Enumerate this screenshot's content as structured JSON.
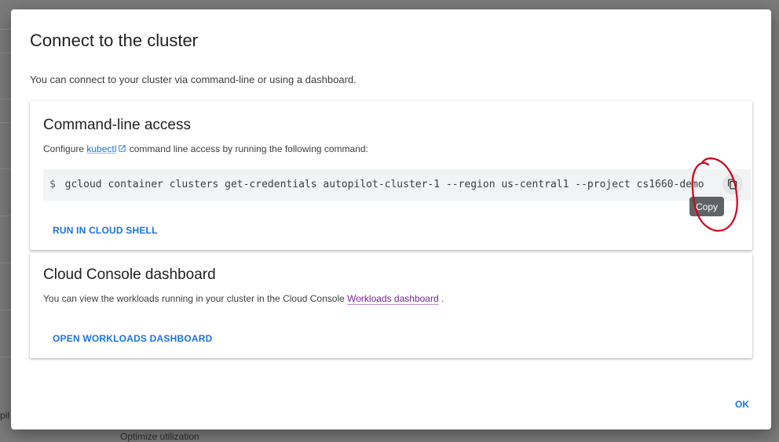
{
  "background": {
    "left_fragment": "pil",
    "bottom_fragment": "Optimize utilization"
  },
  "dialog": {
    "title": "Connect to the cluster",
    "subtitle": "You can connect to your cluster via command-line or using a dashboard.",
    "cli": {
      "title": "Command-line access",
      "text_before": "Configure ",
      "link_label": "kubectl",
      "link_icon": "external-link-icon",
      "text_after": " command line access by running the following command:",
      "prompt": "$",
      "command": "gcloud container clusters get-credentials autopilot-cluster-1 --region us-central1 --project cs1660-demo",
      "copy_icon": "copy-icon",
      "tooltip": "Copy",
      "run_button": "RUN IN CLOUD SHELL"
    },
    "dashboard": {
      "title": "Cloud Console dashboard",
      "text_before": "You can view the workloads running in your cluster in the Cloud Console ",
      "link_label": "Workloads dashboard",
      "text_after": " .",
      "open_button": "OPEN WORKLOADS DASHBOARD"
    },
    "ok_button": "OK"
  },
  "colors": {
    "accent": "#1a73e8",
    "link_visited": "#7b1fa2",
    "annotation": "#d0021b"
  }
}
